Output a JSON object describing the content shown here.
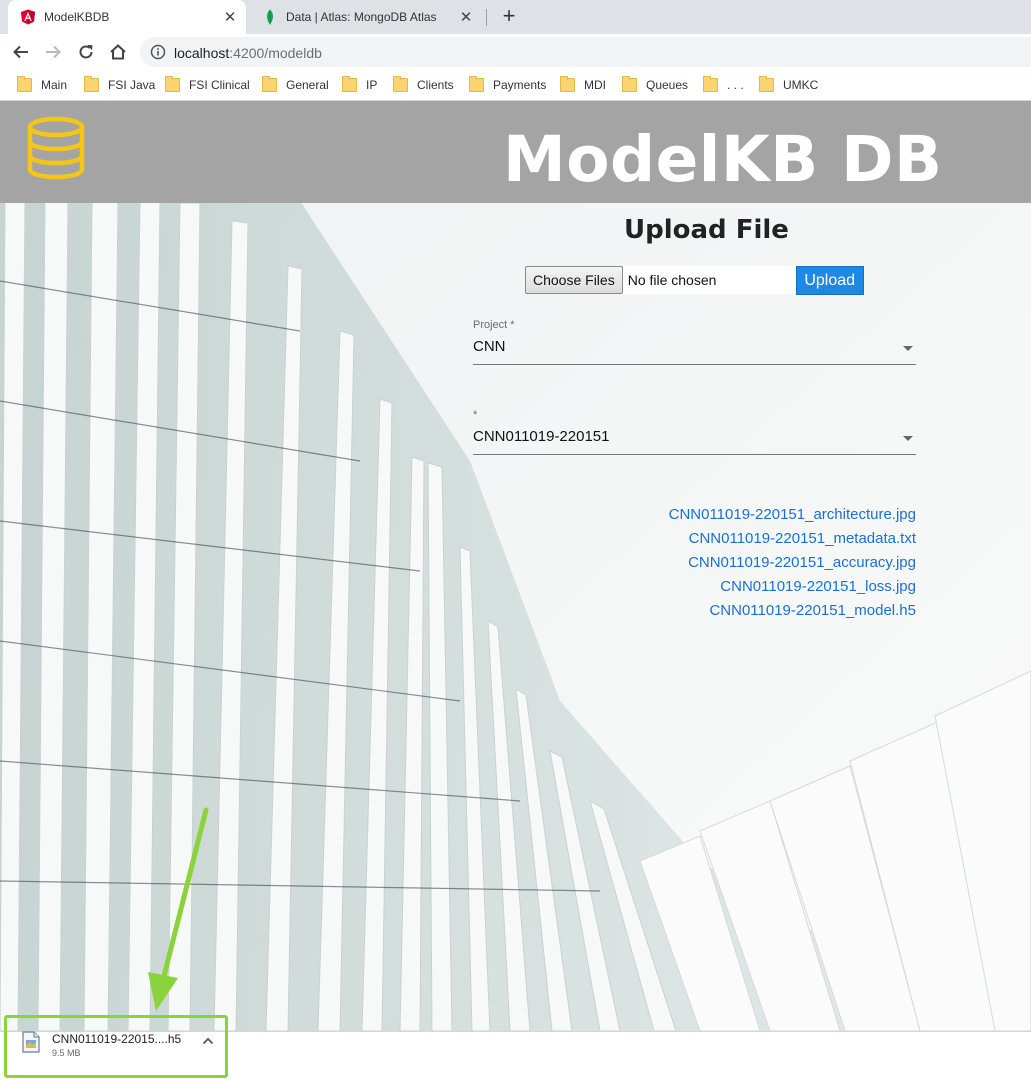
{
  "browser": {
    "tabs": [
      {
        "title": "ModelKBDB",
        "icon": "angular-icon",
        "active": true
      },
      {
        "title": "Data | Atlas: MongoDB Atlas",
        "icon": "mongodb-leaf-icon",
        "active": false
      }
    ],
    "new_tab": "+",
    "close_glyph": "✕",
    "url_host": "localhost",
    "url_path": ":4200/modeldb",
    "bookmarks": [
      "Main",
      "FSI Java",
      "FSI Clinical",
      "General",
      "IP",
      "Clients",
      "Payments",
      "MDI",
      "Queues",
      ". . .",
      "UMKC"
    ]
  },
  "app": {
    "title": "ModelKB DB",
    "logo": "database-icon",
    "accent": "#f5c518",
    "header_color": "#a4a4a4"
  },
  "upload": {
    "title": "Upload File",
    "choose_label": "Choose Files",
    "no_file": "No file chosen",
    "upload_label": "Upload"
  },
  "form": {
    "project": {
      "label": "Project *",
      "value": "CNN"
    },
    "model": {
      "label": "*",
      "value": "CNN011019-220151"
    }
  },
  "files": [
    "CNN011019-220151_architecture.jpg",
    "CNN011019-220151_metadata.txt",
    "CNN011019-220151_accuracy.jpg",
    "CNN011019-220151_loss.jpg",
    "CNN011019-220151_model.h5"
  ],
  "download": {
    "name": "CNN011019-22015....h5",
    "size": "9.5 MB",
    "highlight_color": "#8bd33a"
  }
}
